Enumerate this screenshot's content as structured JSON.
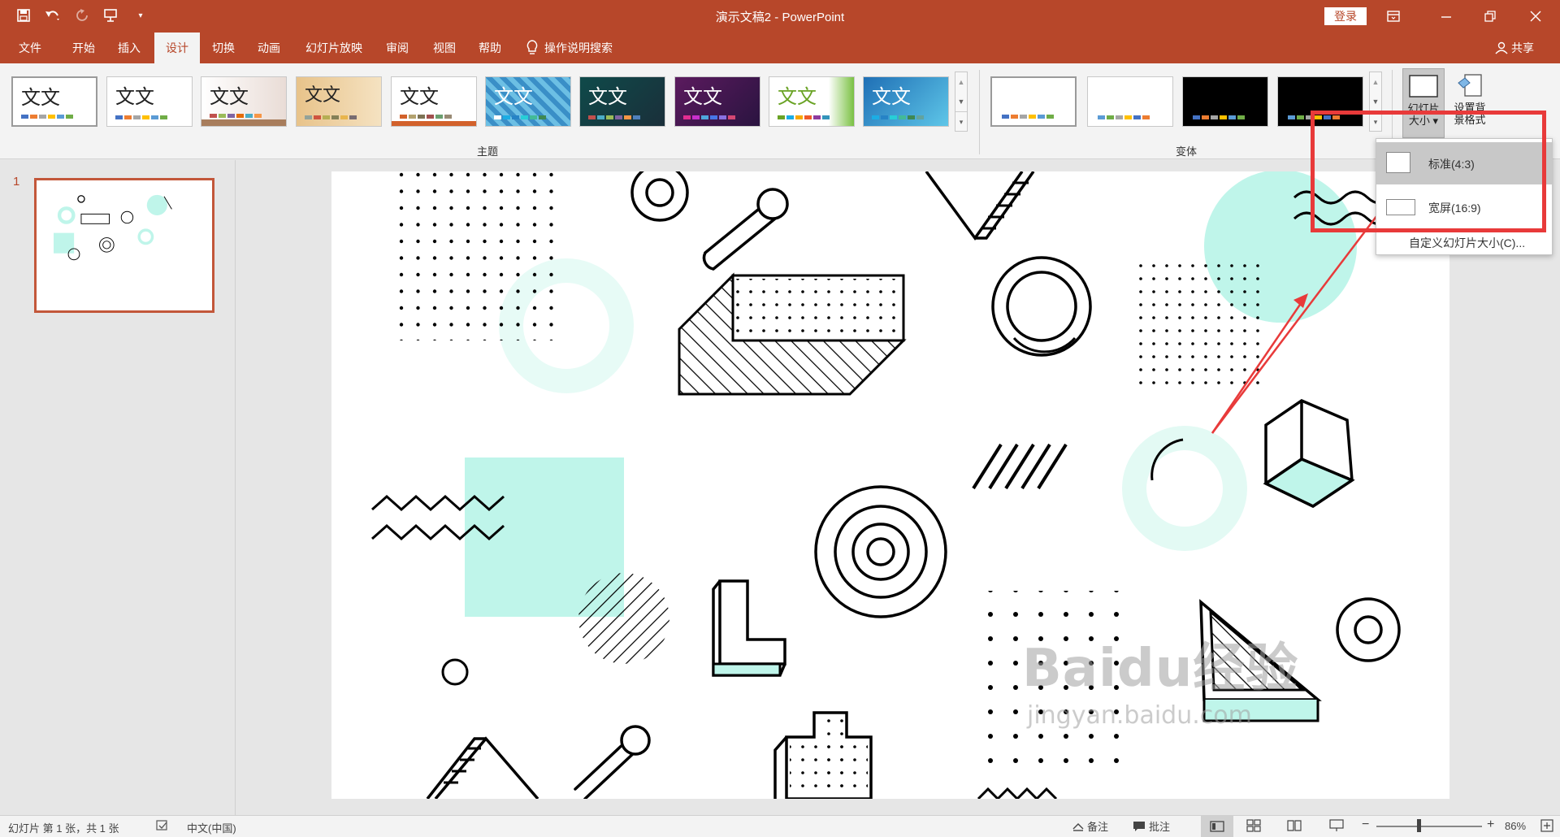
{
  "window": {
    "title": "演示文稿2 - PowerPoint",
    "login": "登录"
  },
  "tabs": [
    {
      "label": "文件"
    },
    {
      "label": "开始"
    },
    {
      "label": "插入"
    },
    {
      "label": "设计"
    },
    {
      "label": "切换"
    },
    {
      "label": "动画"
    },
    {
      "label": "幻灯片放映"
    },
    {
      "label": "审阅"
    },
    {
      "label": "视图"
    },
    {
      "label": "帮助"
    }
  ],
  "active_tab": "设计",
  "tellme": "操作说明搜索",
  "share": "共享",
  "ribbon": {
    "themes_group_label": "主题",
    "variants_group_label": "变体",
    "theme_sample_text": "文文",
    "slide_size_label_1": "幻灯片",
    "slide_size_label_2": "大小",
    "format_bg_label_1": "设置背",
    "format_bg_label_2": "景格式"
  },
  "slide_size_menu": {
    "standard": "标准(4:3)",
    "widescreen": "宽屏(16:9)",
    "custom": "自定义幻灯片大小(C)..."
  },
  "slides_pane": {
    "number": "1"
  },
  "statusbar": {
    "slide_info": "幻灯片 第 1 张，共 1 张",
    "language": "中文(中国)",
    "notes": "备注",
    "comments": "批注",
    "zoom": "86%"
  },
  "watermark": {
    "brand": "Baidu经验",
    "url": "jingyan.baidu.com"
  },
  "colors": {
    "accent": "#b7472a",
    "mint": "#bff5ea",
    "highlight_red": "#e83a3a"
  }
}
